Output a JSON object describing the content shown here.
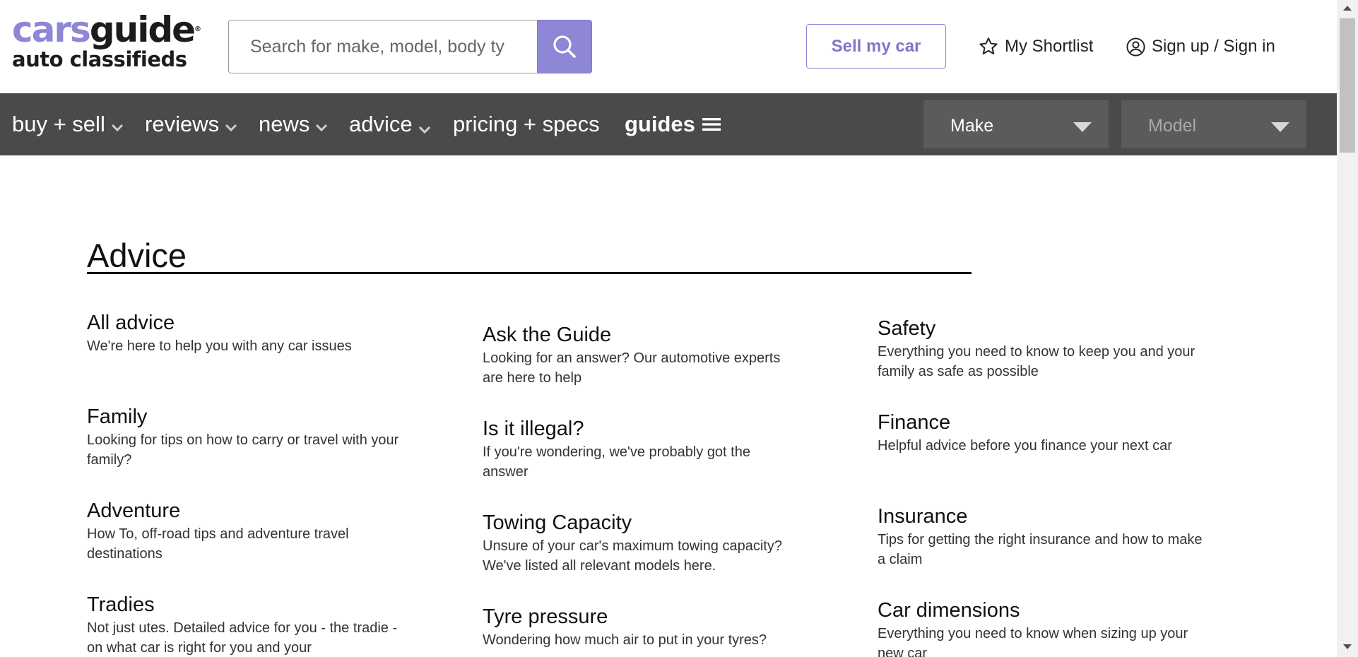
{
  "header": {
    "logo_top_a": "cars",
    "logo_top_b": "guide",
    "logo_reg": "®",
    "logo_bottom": "auto classifieds",
    "search_placeholder": "Search for make, model, body ty",
    "sell_label": "Sell my car",
    "shortlist_label": "My Shortlist",
    "signin_label": "Sign up / Sign in",
    "icons": {
      "search": "search-icon",
      "shortlist": "star-icon",
      "account": "user-circle-icon"
    }
  },
  "nav": {
    "items": [
      {
        "label": "buy + sell",
        "has_dropdown": true
      },
      {
        "label": "reviews",
        "has_dropdown": true
      },
      {
        "label": "news",
        "has_dropdown": true
      },
      {
        "label": "advice",
        "has_dropdown": true
      },
      {
        "label": "pricing + specs",
        "has_dropdown": false
      }
    ],
    "guides_label": "guides",
    "make_label": "Make",
    "model_label": "Model"
  },
  "main": {
    "title": "Advice",
    "columns": [
      [
        {
          "title": "All advice",
          "desc": "We're here to help you with any car issues"
        },
        {
          "title": "Family",
          "desc": "Looking for tips on how to carry or travel with your family?"
        },
        {
          "title": "Adventure",
          "desc": "How To, off-road tips and adventure travel destinations"
        },
        {
          "title": "Tradies",
          "desc": "Not just utes. Detailed advice for you - the tradie - on what car is right for you and your"
        }
      ],
      [
        {
          "title": "Ask the Guide",
          "desc": "Looking for an answer? Our automotive experts are here to help"
        },
        {
          "title": "Is it illegal?",
          "desc": "If you're wondering, we've probably got the answer"
        },
        {
          "title": "Towing Capacity",
          "desc": "Unsure of your car's maximum towing capacity? We've listed all relevant models here."
        },
        {
          "title": "Tyre pressure",
          "desc": "Wondering how much air to put in your tyres?"
        }
      ],
      [
        {
          "title": "Safety",
          "desc": "Everything you need to know to keep you and your family as safe as possible"
        },
        {
          "title": "Finance",
          "desc": "Helpful advice before you finance your next car"
        },
        {
          "title": "Insurance",
          "desc": "Tips for getting the right insurance and how to make a claim"
        },
        {
          "title": "Car dimensions",
          "desc": "Everything you need to know when sizing up your new car"
        }
      ]
    ]
  },
  "colors": {
    "brand": "#8e86d6",
    "nav_bg": "#4a4a4a",
    "text": "#1a1a1a"
  }
}
